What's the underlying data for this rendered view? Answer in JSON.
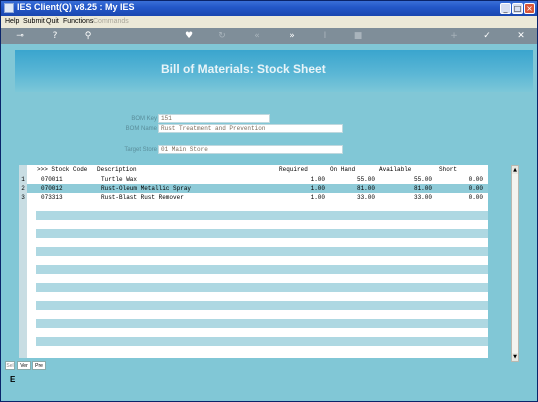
{
  "window": {
    "title": "IES Client(Q) v8.25 : My IES"
  },
  "menu": {
    "items": [
      "Help",
      "Submit",
      "Quit",
      "Functions"
    ],
    "disabled_item": "Commands"
  },
  "toolbar": {
    "icons": [
      "key-icon",
      "help-icon",
      "search-icon",
      "heart-icon",
      "refresh-icon",
      "rewind-icon",
      "fast-forward-icon",
      "text-cursor-icon",
      "stop-icon",
      "plus-icon",
      "check-icon",
      "close-icon"
    ]
  },
  "page": {
    "title": "Bill of Materials: Stock Sheet"
  },
  "form": {
    "bom_key_label": "BOM Key",
    "bom_key_value": "151",
    "bom_name_label": "BOM Name",
    "bom_name_value": "Rust Treatment and Prevention",
    "target_store_label": "Target Store",
    "target_store_value": "01 Main Store"
  },
  "grid": {
    "columns": {
      "code": ">>> Stock Code",
      "desc": "Description",
      "required": "Required",
      "onhand": "On Hand",
      "available": "Available",
      "short": "Short"
    },
    "rows": [
      {
        "n": "1",
        "code": "070011",
        "desc": "Turtle Wax",
        "required": "1.00",
        "onhand": "55.00",
        "available": "55.00",
        "short": "0.00"
      },
      {
        "n": "2",
        "code": "070012",
        "desc": "Rust-Oleum Metallic Spray",
        "required": "1.00",
        "onhand": "81.00",
        "available": "81.00",
        "short": "0.00"
      },
      {
        "n": "3",
        "code": "073313",
        "desc": "Rust-Blast Rust Remover",
        "required": "1.00",
        "onhand": "33.00",
        "available": "33.00",
        "short": "0.00"
      }
    ]
  },
  "tabs": [
    "Sel",
    "Ver",
    "Pre"
  ],
  "marker": "E",
  "colors": {
    "client_bg": "#81c7d6",
    "header_band": "#3aa5ce",
    "selected_row": "#8fcbd8",
    "toolbar": "#7f8e99"
  }
}
